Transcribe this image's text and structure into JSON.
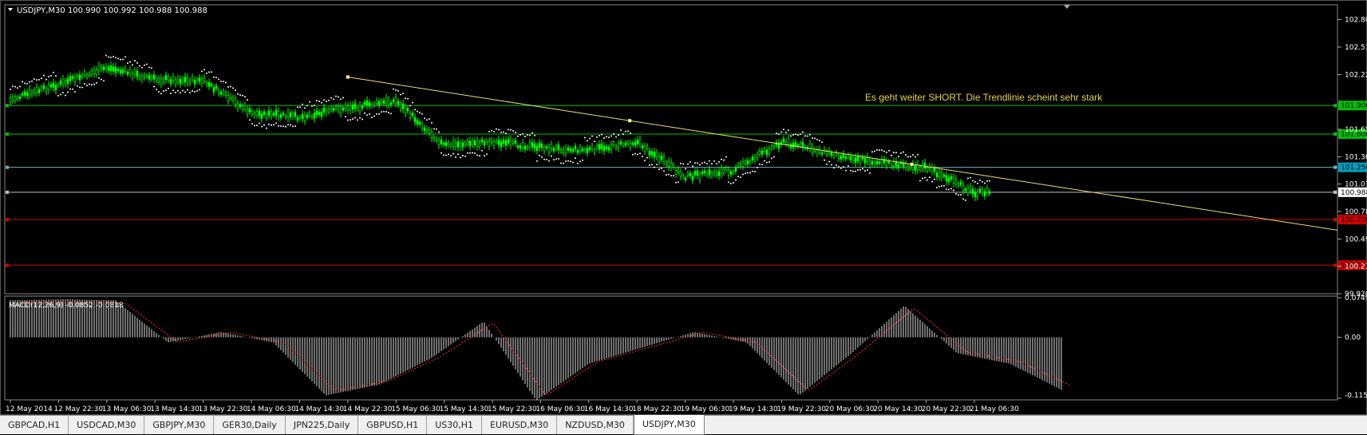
{
  "chart_header": {
    "symbol_text": "USDJPY,M30  100.990 100.992 100.988 100.988"
  },
  "annotation_text": "Es geht weiter SHORT. Die Trendlinie scheint sehr stark",
  "price_axis": {
    "ticks": [
      "102.805",
      "102.515",
      "102.225",
      "101.650",
      "101.360",
      "101.075",
      "100.785",
      "100.495",
      "100.210",
      "99.920"
    ],
    "level_labels": [
      {
        "text": "101.900",
        "color": "#00c000"
      },
      {
        "text": "101.600",
        "color": "#00c000"
      },
      {
        "text": "101.250",
        "color": "#00a0c0"
      },
      {
        "text": "100.988",
        "color": "#ffffff"
      },
      {
        "text": "100.700",
        "color": "#d00000"
      },
      {
        "text": "100.220",
        "color": "#d00000"
      }
    ]
  },
  "macd": {
    "label": "MACD(12,26,9) -0.0852 -0.0818",
    "ticks": [
      "0.0749",
      "0.00",
      "-0.1155"
    ]
  },
  "time_axis": {
    "labels": [
      "12 May 2014",
      "12 May 22:30",
      "13 May 06:30",
      "13 May 14:30",
      "13 May 22:30",
      "14 May 06:30",
      "14 May 14:30",
      "14 May 22:30",
      "15 May 06:30",
      "15 May 14:30",
      "15 May 22:30",
      "16 May 06:30",
      "16 May 14:30",
      "18 May 22:30",
      "19 May 06:30",
      "19 May 14:30",
      "19 May 22:30",
      "20 May 06:30",
      "20 May 14:30",
      "20 May 22:30",
      "21 May 06:30"
    ]
  },
  "tabs": [
    "GBPCAD,H1",
    "USDCAD,M30",
    "GBPJPY,M30",
    "GER30,Daily",
    "JPN225,Daily",
    "GBPUSD,H1",
    "US30,H1",
    "EURUSD,M30",
    "NZDUSD,M30",
    "USDJPY,M30"
  ],
  "active_tab": "USDJPY,M30",
  "chart_data": {
    "type": "line",
    "title": "USDJPY,M30",
    "close_series": [
      {
        "x": "12 May 2014",
        "y": 101.96
      },
      {
        "x": "12 May 22:30",
        "y": 102.12
      },
      {
        "x": "13 May 06:30",
        "y": 102.3
      },
      {
        "x": "13 May 14:30",
        "y": 102.18
      },
      {
        "x": "13 May 22:30",
        "y": 102.16
      },
      {
        "x": "14 May 06:30",
        "y": 101.82
      },
      {
        "x": "14 May 14:30",
        "y": 101.78
      },
      {
        "x": "14 May 22:30",
        "y": 101.88
      },
      {
        "x": "15 May 06:30",
        "y": 101.95
      },
      {
        "x": "15 May 14:30",
        "y": 101.48
      },
      {
        "x": "15 May 22:30",
        "y": 101.52
      },
      {
        "x": "16 May 06:30",
        "y": 101.46
      },
      {
        "x": "16 May 14:30",
        "y": 101.43
      },
      {
        "x": "18 May 22:30",
        "y": 101.52
      },
      {
        "x": "19 May 06:30",
        "y": 101.15
      },
      {
        "x": "19 May 14:30",
        "y": 101.22
      },
      {
        "x": "19 May 22:30",
        "y": 101.52
      },
      {
        "x": "20 May 06:30",
        "y": 101.4
      },
      {
        "x": "20 May 14:30",
        "y": 101.3
      },
      {
        "x": "20 May 22:30",
        "y": 101.25
      },
      {
        "x": "21 May 06:30",
        "y": 100.988
      }
    ],
    "horizontal_levels": [
      101.9,
      101.6,
      101.25,
      100.988,
      100.7,
      100.22
    ],
    "trendline": [
      {
        "x": "14 May 22:30",
        "y": 102.2
      },
      {
        "x": "21 May 06:30",
        "y": 101.18
      }
    ],
    "macd_hist": [
      0.07,
      0.072,
      0.07,
      -0.01,
      0.01,
      -0.01,
      -0.11,
      -0.09,
      -0.04,
      0.03,
      -0.12,
      -0.05,
      -0.02,
      0.01,
      -0.01,
      -0.11,
      -0.03,
      0.06,
      -0.03,
      -0.05,
      -0.1
    ],
    "ylim": [
      99.92,
      102.96
    ],
    "macd_ylim": [
      -0.1155,
      0.0749
    ]
  }
}
